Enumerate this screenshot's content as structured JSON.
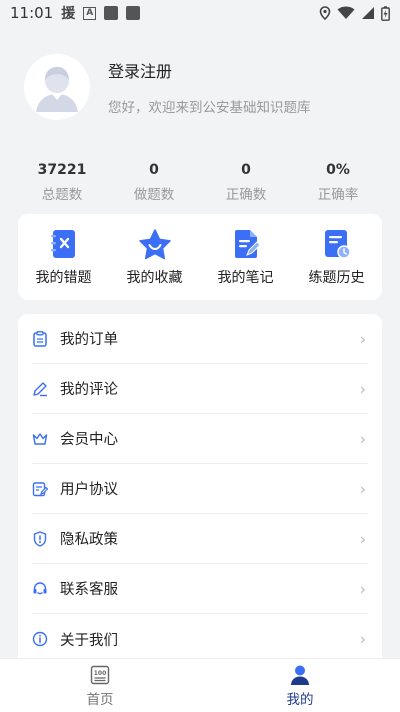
{
  "status_bar": {
    "time": "11:01",
    "glyph_text": "援",
    "a_text": "A"
  },
  "profile": {
    "login_label": "登录注册",
    "welcome": "您好，欢迎来到公安基础知识题库"
  },
  "stats": [
    {
      "value": "37221",
      "label": "总题数"
    },
    {
      "value": "0",
      "label": "做题数"
    },
    {
      "value": "0",
      "label": "正确数"
    },
    {
      "value": "0%",
      "label": "正确率"
    }
  ],
  "tools": [
    {
      "label": "我的错题",
      "icon": "wrong-book-icon"
    },
    {
      "label": "我的收藏",
      "icon": "star-icon"
    },
    {
      "label": "我的笔记",
      "icon": "note-icon"
    },
    {
      "label": "练题历史",
      "icon": "history-icon"
    }
  ],
  "menu": [
    {
      "label": "我的订单",
      "icon": "order-icon"
    },
    {
      "label": "我的评论",
      "icon": "comment-icon"
    },
    {
      "label": "会员中心",
      "icon": "crown-icon"
    },
    {
      "label": "用户协议",
      "icon": "agreement-icon"
    },
    {
      "label": "隐私政策",
      "icon": "shield-icon"
    },
    {
      "label": "联系客服",
      "icon": "headset-icon"
    },
    {
      "label": "关于我们",
      "icon": "info-icon"
    }
  ],
  "nav": [
    {
      "label": "首页",
      "icon": "home-icon",
      "active": false
    },
    {
      "label": "我的",
      "icon": "user-icon",
      "active": true
    }
  ],
  "colors": {
    "accent": "#3b6ff5",
    "nav_active": "#1f3a8a",
    "background": "#f2f3f5"
  }
}
